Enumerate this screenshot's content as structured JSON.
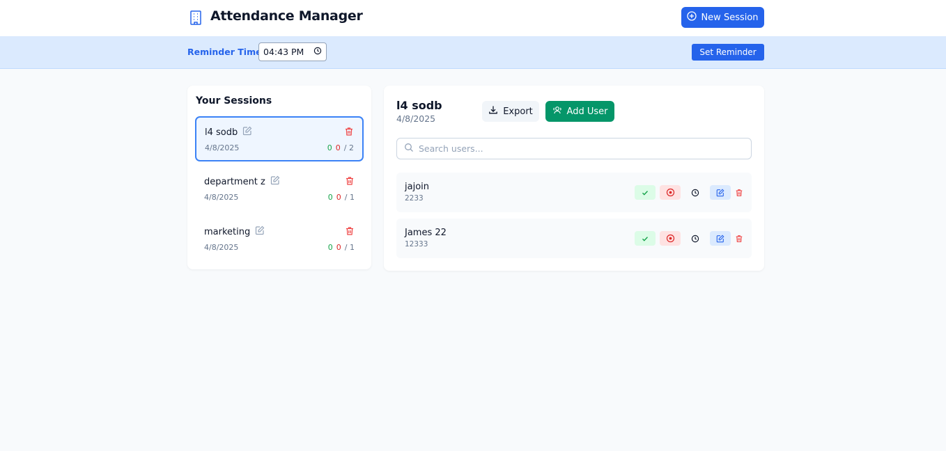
{
  "header": {
    "title": "Attendance Manager",
    "logo_icon": "building-icon",
    "new_session_label": "New Session"
  },
  "reminder": {
    "label": "Reminder Time:",
    "time_value": "04:43 PM",
    "set_label": "Set Reminder"
  },
  "sessions": {
    "title": "Your Sessions",
    "items": [
      {
        "name": "l4 sodb",
        "date": "4/8/2025",
        "present": "0",
        "absent": "0",
        "total": "/ 2",
        "active": true
      },
      {
        "name": "department z",
        "date": "4/8/2025",
        "present": "0",
        "absent": "0",
        "total": "/ 1",
        "active": false
      },
      {
        "name": "marketing",
        "date": "4/8/2025",
        "present": "0",
        "absent": "0",
        "total": "/ 1",
        "active": false
      }
    ]
  },
  "detail": {
    "title": "l4 sodb",
    "date": "4/8/2025",
    "export_label": "Export",
    "add_user_label": "Add User",
    "search_placeholder": "Search users...",
    "users": [
      {
        "name": "jajoin",
        "id": "2233"
      },
      {
        "name": "James 22",
        "id": "12333"
      }
    ]
  },
  "colors": {
    "primary": "#2563eb",
    "success": "#059669",
    "present": "#16a34a",
    "absent": "#dc2626",
    "reminder_bar": "#dbeafe",
    "background": "#f8fafc"
  }
}
